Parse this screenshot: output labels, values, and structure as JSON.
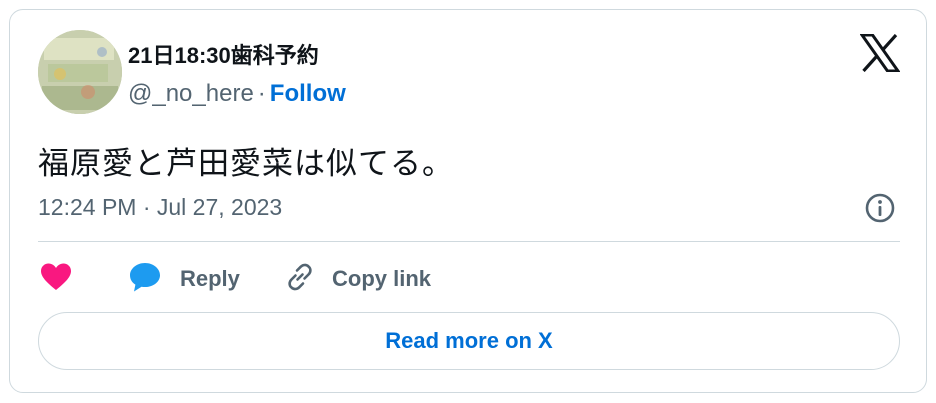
{
  "author": {
    "display_name": "21日18:30歯科予約",
    "handle": "@_no_here",
    "separator": "·",
    "follow_label": "Follow"
  },
  "tweet": {
    "text": "福原愛と芦田愛菜は似てる。",
    "timestamp": "12:24 PM · Jul 27, 2023"
  },
  "actions": {
    "like_icon": "heart-icon",
    "reply_label": "Reply",
    "copy_link_label": "Copy link"
  },
  "read_more_label": "Read more on X",
  "colors": {
    "link": "#006fd6",
    "like": "#f91880",
    "reply": "#1d9bf0",
    "muted": "#536471",
    "border": "#cfd9de"
  }
}
